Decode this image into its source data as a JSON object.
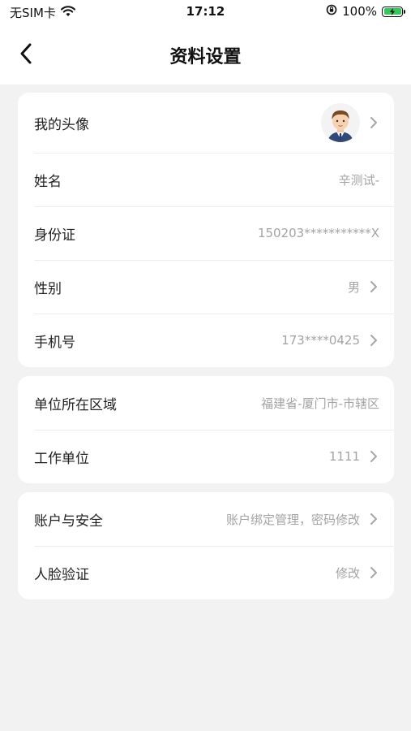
{
  "status_bar": {
    "carrier": "无SIM卡",
    "time": "17:12",
    "battery": "100%"
  },
  "nav": {
    "title": "资料设置"
  },
  "profile": {
    "avatar_label": "我的头像",
    "name_label": "姓名",
    "name_value": "辛测试-",
    "id_label": "身份证",
    "id_value": "150203***********X",
    "gender_label": "性别",
    "gender_value": "男",
    "phone_label": "手机号",
    "phone_value": "173****0425"
  },
  "work": {
    "region_label": "单位所在区域",
    "region_value": "福建省-厦门市-市辖区",
    "company_label": "工作单位",
    "company_value": "1111"
  },
  "security": {
    "account_label": "账户与安全",
    "account_value": "账户绑定管理，密码修改",
    "face_label": "人脸验证",
    "face_value": "修改"
  }
}
